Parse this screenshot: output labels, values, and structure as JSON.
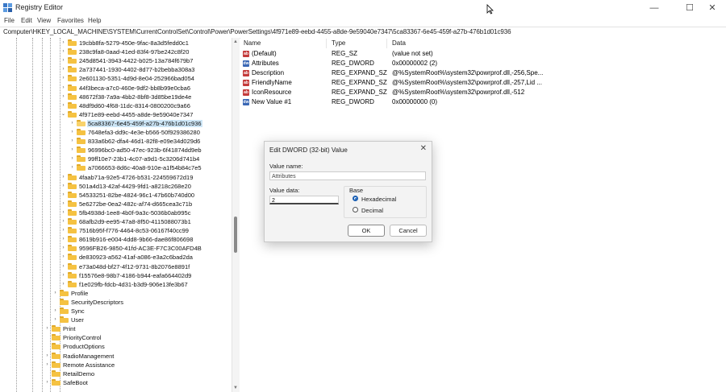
{
  "window": {
    "title": "Registry Editor",
    "controls": {
      "minimize": "—",
      "maximize": "☐",
      "close": "✕"
    }
  },
  "menu": [
    "File",
    "Edit",
    "View",
    "Favorites",
    "Help"
  ],
  "address": "Computer\\HKEY_LOCAL_MACHINE\\SYSTEM\\CurrentControlSet\\Control\\Power\\PowerSettings\\4f971e89-eebd-4455-a8de-9e59040e7347\\5ca83367-6e45-459f-a27b-476b1d01c936",
  "tree": [
    {
      "label": "19cbb8fa-5279-450e-9fac-8a3d5fedd0c1",
      "depth": 4,
      "expander": ">"
    },
    {
      "label": "238c9fa8-0aad-41ed-83f4-97be242c8f20",
      "depth": 4,
      "expander": ">"
    },
    {
      "label": "245d8541-3943-4422-b025-13a784f679b7",
      "depth": 4,
      "expander": ">"
    },
    {
      "label": "2a737441-1930-4402-8d77-b2bebba308a3",
      "depth": 4,
      "expander": ">"
    },
    {
      "label": "2e601130-5351-4d9d-8e04-252966bad054",
      "depth": 4,
      "expander": ">"
    },
    {
      "label": "44f3beca-a7c0-460e-9df2-bb8b99e0cba6",
      "depth": 4,
      "expander": ">"
    },
    {
      "label": "48672f38-7a9a-4bb2-8bf8-3d85be19de4e",
      "depth": 4,
      "expander": ">"
    },
    {
      "label": "48df9d60-4f68-11dc-8314-0800200c9a66",
      "depth": 4,
      "expander": ">"
    },
    {
      "label": "4f971e89-eebd-4455-a8de-9e59040e7347",
      "depth": 4,
      "expander": "v"
    },
    {
      "label": "5ca83367-6e45-459f-a27b-476b1d01c936",
      "depth": 5,
      "expander": ">",
      "selected": true
    },
    {
      "label": "7648efa3-dd9c-4e3e-b566-50f929386280",
      "depth": 5,
      "expander": ">"
    },
    {
      "label": "833a6b62-dfa4-46d1-82f8-e09e34d029d6",
      "depth": 5,
      "expander": ">"
    },
    {
      "label": "96996bc0-ad50-47ec-923b-6f41874dd9eb",
      "depth": 5,
      "expander": ">"
    },
    {
      "label": "99ff10e7-23b1-4c07-a9d1-5c3206d741b4",
      "depth": 5,
      "expander": ">"
    },
    {
      "label": "a7066653-8d6c-40a8-910e-a1f54b84c7e5",
      "depth": 5,
      "expander": ">"
    },
    {
      "label": "4faab71a-92e5-4726-b531-224559672d19",
      "depth": 4,
      "expander": ">"
    },
    {
      "label": "501a4d13-42af-4429-9fd1-a8218c268e20",
      "depth": 4,
      "expander": ">"
    },
    {
      "label": "54533251-82be-4824-96c1-47b60b740d00",
      "depth": 4,
      "expander": ">"
    },
    {
      "label": "5e6272be-0ea2-482c-af74-d665cea3c71b",
      "depth": 4,
      "expander": ">"
    },
    {
      "label": "5fb4938d-1ee8-4b0f-9a3c-5036b0ab995c",
      "depth": 4,
      "expander": ">"
    },
    {
      "label": "68afb2d9-ee95-47a8-8f50-4115088073b1",
      "depth": 4,
      "expander": ">"
    },
    {
      "label": "7516b95f-f776-4464-8c53-06167f40cc99",
      "depth": 4,
      "expander": ">"
    },
    {
      "label": "8619b916-e004-4dd8-9b66-dae86f806698",
      "depth": 4,
      "expander": ">"
    },
    {
      "label": "9596FB26-9850-41fd-AC3E-F7C3C00AFD4B",
      "depth": 4,
      "expander": ">"
    },
    {
      "label": "de830923-a562-41af-a086-e3a2c6bad2da",
      "depth": 4,
      "expander": ">"
    },
    {
      "label": "e73a048d-bf27-4f12-9731-8b2076e8891f",
      "depth": 4,
      "expander": ">"
    },
    {
      "label": "f15576e8-98b7-4186-b944-eafa664402d9",
      "depth": 4,
      "expander": ">"
    },
    {
      "label": "f1e029fb-fdcb-4d31-b3d9-906e13fe3b67",
      "depth": 4,
      "expander": ">"
    },
    {
      "label": "Profile",
      "depth": 3,
      "expander": ">"
    },
    {
      "label": "SecurityDescriptors",
      "depth": 3,
      "expander": ""
    },
    {
      "label": "Sync",
      "depth": 3,
      "expander": ">"
    },
    {
      "label": "User",
      "depth": 3,
      "expander": ">"
    },
    {
      "label": "Print",
      "depth": 2,
      "expander": ">"
    },
    {
      "label": "PriorityControl",
      "depth": 2,
      "expander": ""
    },
    {
      "label": "ProductOptions",
      "depth": 2,
      "expander": ""
    },
    {
      "label": "RadioManagement",
      "depth": 2,
      "expander": ">"
    },
    {
      "label": "Remote Assistance",
      "depth": 2,
      "expander": ">"
    },
    {
      "label": "RetailDemo",
      "depth": 2,
      "expander": ""
    },
    {
      "label": "SafeBoot",
      "depth": 2,
      "expander": ">"
    }
  ],
  "columns": {
    "name": "Name",
    "type": "Type",
    "data": "Data"
  },
  "values": [
    {
      "name": "(Default)",
      "type": "REG_SZ",
      "data": "(value not set)",
      "icon": "ab"
    },
    {
      "name": "Attributes",
      "type": "REG_DWORD",
      "data": "0x00000002 (2)",
      "icon": "dw"
    },
    {
      "name": "Description",
      "type": "REG_EXPAND_SZ",
      "data": "@%SystemRoot%\\system32\\powrprof.dll,-256,Spe...",
      "icon": "ab"
    },
    {
      "name": "FriendlyName",
      "type": "REG_EXPAND_SZ",
      "data": "@%SystemRoot%\\system32\\powrprof.dll,-257,Lid ...",
      "icon": "ab"
    },
    {
      "name": "IconResource",
      "type": "REG_EXPAND_SZ",
      "data": "@%SystemRoot%\\system32\\powrprof.dll,-512",
      "icon": "ab"
    },
    {
      "name": "New Value #1",
      "type": "REG_DWORD",
      "data": "0x00000000 (0)",
      "icon": "dw"
    }
  ],
  "dialog": {
    "title": "Edit DWORD (32-bit) Value",
    "close": "✕",
    "value_name_label": "Value name:",
    "value_name": "Attributes",
    "value_data_label": "Value data:",
    "value_data": "2",
    "base_label": "Base",
    "hex_label": "Hexadecimal",
    "dec_label": "Decimal",
    "base_selected": "Hexadecimal",
    "ok_label": "OK",
    "cancel_label": "Cancel"
  },
  "colors": {
    "folder": "#f5c242",
    "selection": "#cde6f7",
    "radio_accent": "#1a5fb4"
  }
}
